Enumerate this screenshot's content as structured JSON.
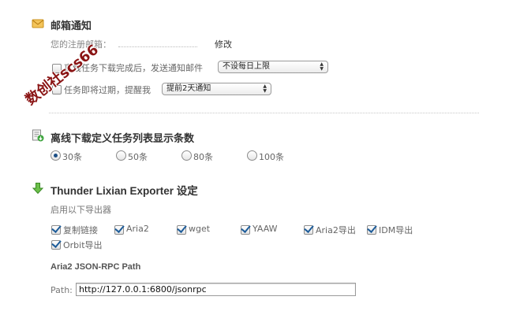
{
  "watermark": "数创社scs66",
  "email": {
    "title": "邮箱通知",
    "your_email_label": "您的注册邮箱：",
    "modify_link": "修改",
    "notify_label": "离线任务下载完成后，发送通知邮件",
    "notify_checked": false,
    "notify_select": "不设每日上限",
    "expire_label": "任务即将过期，提醒我",
    "expire_checked": false,
    "expire_select": "提前2天通知"
  },
  "display": {
    "title": "离线下载定义任务列表显示条数",
    "options": [
      {
        "label": "30条",
        "selected": true
      },
      {
        "label": "50条",
        "selected": false
      },
      {
        "label": "80条",
        "selected": false
      },
      {
        "label": "100条",
        "selected": false
      }
    ]
  },
  "exporter": {
    "title": "Thunder Lixian Exporter 设定",
    "enable_label": "启用以下导出器",
    "items": [
      {
        "label": "复制链接",
        "checked": true
      },
      {
        "label": "Aria2",
        "checked": true
      },
      {
        "label": "wget",
        "checked": true
      },
      {
        "label": "YAAW",
        "checked": true
      },
      {
        "label": "Aria2导出",
        "checked": true
      },
      {
        "label": "IDM导出",
        "checked": true
      },
      {
        "label": "Orbit导出",
        "checked": true
      }
    ],
    "rpc_title": "Aria2 JSON-RPC Path",
    "path_label": "Path:",
    "path_value": "http://127.0.0.1:6800/jsonrpc"
  },
  "colors": {
    "accent_check": "#1e5d9a",
    "watermark": "#8a1414",
    "icon_envelope": "#e0a82e",
    "icon_arrow": "#4aa83c"
  },
  "icons": {
    "email_icon": "envelope-icon",
    "display_icon": "list-settings-icon",
    "exporter_icon": "download-arrow-icon"
  }
}
